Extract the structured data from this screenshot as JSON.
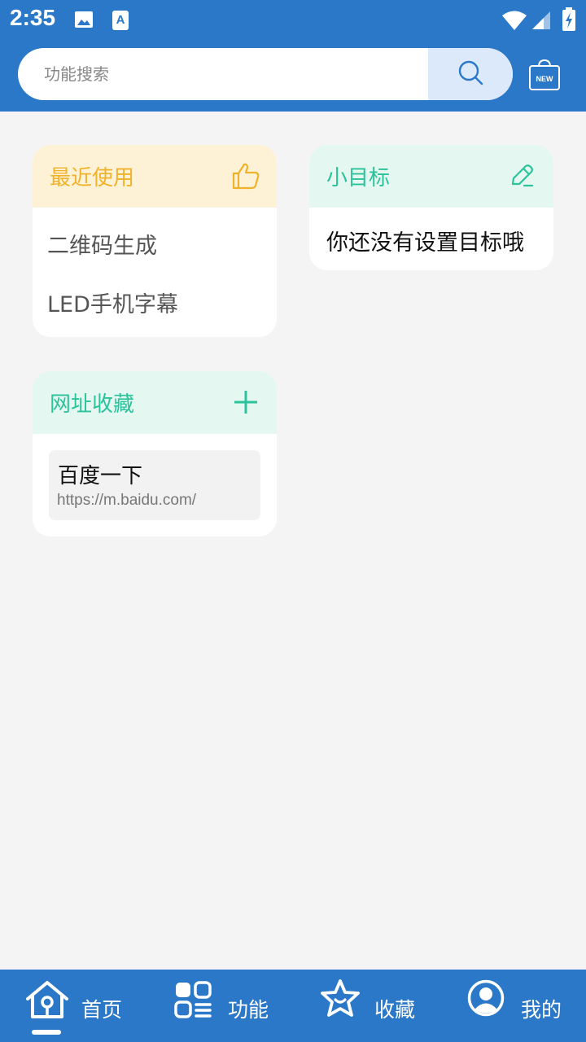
{
  "status_bar": {
    "time": "2:35",
    "icons": [
      "image-icon",
      "text-a-icon",
      "wifi-icon",
      "signal-icon",
      "battery-charging-icon"
    ]
  },
  "search": {
    "placeholder": "功能搜索",
    "value": ""
  },
  "cards": {
    "recent": {
      "title": "最近使用",
      "items": [
        "二维码生成",
        "LED手机字幕"
      ],
      "accent": "#f0b22c",
      "header_bg": "#fdf2d6"
    },
    "goals": {
      "title": "小目标",
      "empty_text": "你还没有设置目标哦",
      "accent": "#2bc39a",
      "header_bg": "#e4f7f1"
    },
    "bookmarks": {
      "title": "网址收藏",
      "items": [
        {
          "name": "百度一下",
          "url": "https://m.baidu.com/"
        }
      ],
      "accent": "#2bc39a"
    }
  },
  "bottom_nav": {
    "items": [
      {
        "label": "首页",
        "icon": "home-icon",
        "active": true
      },
      {
        "label": "功能",
        "icon": "apps-icon",
        "active": false
      },
      {
        "label": "收藏",
        "icon": "star-icon",
        "active": false
      },
      {
        "label": "我的",
        "icon": "profile-icon",
        "active": false
      }
    ]
  },
  "colors": {
    "primary": "#2c78c8",
    "background": "#f4f4f4",
    "search_button_bg": "#dce9fb"
  }
}
